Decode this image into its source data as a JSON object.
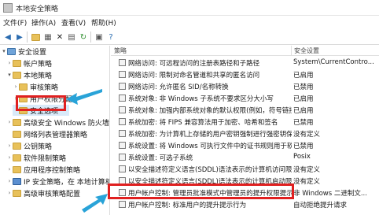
{
  "window": {
    "title": "本地安全策略"
  },
  "menubar": {
    "items": [
      "文件(F)",
      "操作(A)",
      "查看(V)",
      "帮助(H)"
    ]
  },
  "toolbar": {
    "icons": [
      "back-arrow-icon",
      "forward-arrow-icon",
      "up-folder-icon",
      "show-tree-icon",
      "delete-icon",
      "properties-icon",
      "refresh-icon",
      "export-icon",
      "help-icon"
    ]
  },
  "tree": {
    "items": [
      {
        "label": "安全设置",
        "indent": 0,
        "expander": "▾",
        "icon": "blue"
      },
      {
        "label": "帐户策略",
        "indent": 1,
        "expander": "›",
        "icon": "yellow"
      },
      {
        "label": "本地策略",
        "indent": 1,
        "expander": "▾",
        "icon": "yellow"
      },
      {
        "label": "审核策略",
        "indent": 2,
        "expander": "›",
        "icon": "yellow"
      },
      {
        "label": "用户权限分配",
        "indent": 2,
        "expander": "›",
        "icon": "yellow"
      },
      {
        "label": "安全选项",
        "indent": 2,
        "expander": "",
        "icon": "yellow",
        "selected": true
      },
      {
        "label": "高级安全 Windows 防火墙",
        "indent": 1,
        "expander": "›",
        "icon": "yellow"
      },
      {
        "label": "网络列表管理器策略",
        "indent": 1,
        "expander": "",
        "icon": "yellow"
      },
      {
        "label": "公钥策略",
        "indent": 1,
        "expander": "›",
        "icon": "yellow"
      },
      {
        "label": "软件限制策略",
        "indent": 1,
        "expander": "›",
        "icon": "yellow"
      },
      {
        "label": "应用程序控制策略",
        "indent": 1,
        "expander": "›",
        "icon": "yellow"
      },
      {
        "label": "IP 安全策略，在 本地计算机",
        "indent": 1,
        "expander": "›",
        "icon": "monitor"
      },
      {
        "label": "高级审核策略配置",
        "indent": 1,
        "expander": "›",
        "icon": "yellow"
      }
    ]
  },
  "columns": {
    "policy": "策略",
    "setting": "安全设置"
  },
  "policies": [
    {
      "name": "网络访问: 可远程访问的注册表路径和子路径",
      "setting": "System\\CurrentContro..."
    },
    {
      "name": "网络访问: 限制对命名管道和共享的匿名访问",
      "setting": "已启用"
    },
    {
      "name": "网络访问: 允许匿名 SID/名称转换",
      "setting": "已禁用"
    },
    {
      "name": "系统对象: 非 Windows 子系统不要求区分大小写",
      "setting": "已启用"
    },
    {
      "name": "系统对象: 加强内部系统对象的默认权限(例如，符号链接)",
      "setting": "已启用"
    },
    {
      "name": "系统加密: 将 FIPS 兼容算法用于加密、哈希和签名",
      "setting": "已禁用"
    },
    {
      "name": "系统加密: 为计算机上存储的用户密钥强制进行强密钥保护",
      "setting": "没有定义"
    },
    {
      "name": "系统设置: 将 Windows 可执行文件中的证书规则用于软件限制策略",
      "setting": "已禁用"
    },
    {
      "name": "系统设置: 可选子系统",
      "setting": "Posix"
    },
    {
      "name": "以安全描述符定义语言(SDDL)语法表示的计算机访问限制",
      "setting": "没有定义"
    },
    {
      "name": "以安全描述符定义语言(SDDL)语法表示的计算机启动限制",
      "setting": "没有定义"
    },
    {
      "name": "用户帐户控制: 管理员批准模式中管理员的提升权限提示的行为",
      "setting": "非 Windows 二进制文..."
    },
    {
      "name": "用户帐户控制: 标准用户的提升提示行为",
      "setting": "自动拒绝提升请求"
    }
  ],
  "colors": {
    "highlight": "#e02020",
    "arrow": "#29a3d8",
    "selection": "#d9eaf9"
  }
}
